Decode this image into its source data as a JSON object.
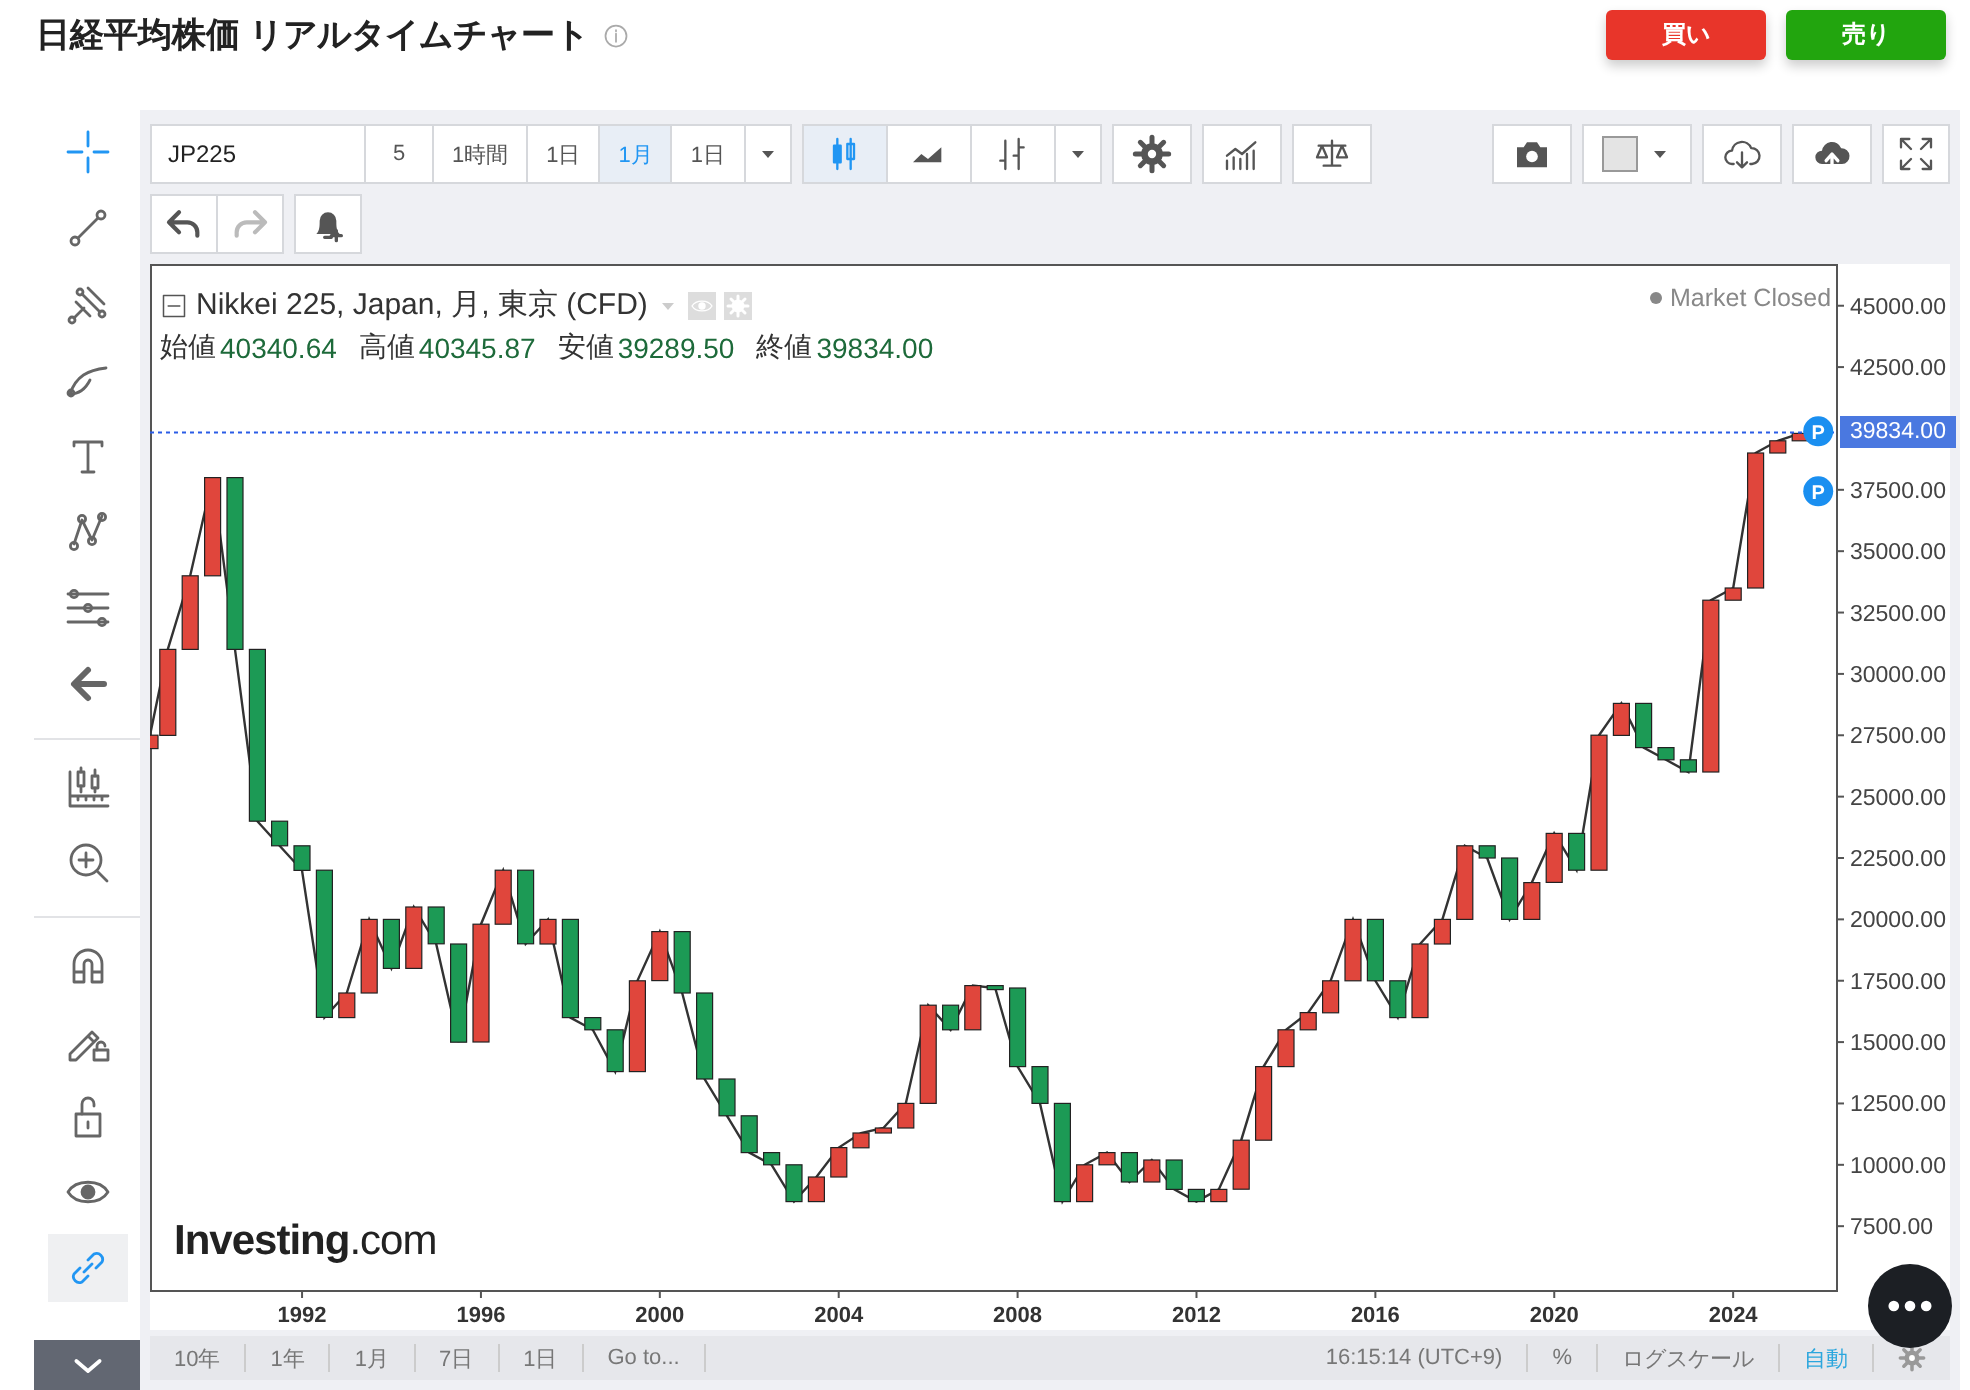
{
  "header": {
    "title": "日経平均株価 リアルタイムチャート",
    "buttons": [
      {
        "label": "買い",
        "kind": "buy"
      },
      {
        "label": "売り",
        "kind": "sell"
      }
    ]
  },
  "drawing_tools": [
    [
      {
        "kind": "crosshair",
        "selected": true,
        "on": false
      },
      {
        "kind": "trend-line",
        "selected": false,
        "on": false
      },
      {
        "kind": "pitchfork",
        "selected": false,
        "on": false
      },
      {
        "kind": "brush",
        "selected": false,
        "on": false
      },
      {
        "kind": "text",
        "selected": false,
        "on": false
      },
      {
        "kind": "pattern",
        "selected": false,
        "on": false
      },
      {
        "kind": "fib",
        "selected": false,
        "on": false
      },
      {
        "kind": "back",
        "selected": false,
        "on": false
      }
    ],
    [
      {
        "kind": "measure",
        "selected": false,
        "on": false
      },
      {
        "kind": "zoom",
        "selected": false,
        "on": false
      }
    ],
    [
      {
        "kind": "magnet",
        "selected": false,
        "on": false
      },
      {
        "kind": "pencil-lock",
        "selected": false,
        "on": false
      },
      {
        "kind": "lock",
        "selected": false,
        "on": false
      },
      {
        "kind": "eye",
        "selected": false,
        "on": false
      },
      {
        "kind": "link",
        "selected": true,
        "on": true
      }
    ]
  ],
  "toolbar": {
    "symbol": "JP225",
    "intervals": [
      {
        "label": "5",
        "selected": false
      },
      {
        "label": "1時間",
        "selected": false
      },
      {
        "label": "1日",
        "selected": false
      },
      {
        "label": "1月",
        "selected": true
      },
      {
        "label": "1日",
        "selected": false
      }
    ],
    "chart_types": [
      {
        "kind": "candles",
        "selected": true
      },
      {
        "kind": "area",
        "selected": false
      },
      {
        "kind": "bars",
        "selected": false
      }
    ],
    "actions": [
      {
        "kind": "settings"
      },
      {
        "kind": "indicators"
      },
      {
        "kind": "scale"
      }
    ],
    "right_actions": [
      {
        "kind": "camera"
      },
      {
        "kind": "color"
      },
      {
        "kind": "cloud-down"
      },
      {
        "kind": "cloud-up"
      },
      {
        "kind": "fullscreen"
      }
    ],
    "history": [
      {
        "kind": "undo",
        "disabled": false
      },
      {
        "kind": "redo",
        "disabled": true
      },
      {
        "kind": "alert",
        "disabled": false
      }
    ]
  },
  "legend": {
    "title": "Nikkei 225, Japan, 月, 東京 (CFD)",
    "ohlc": [
      {
        "label": "始値",
        "value": "40340.64"
      },
      {
        "label": "高値",
        "value": "40345.87"
      },
      {
        "label": "安値",
        "value": "39289.50"
      },
      {
        "label": "終値",
        "value": "39834.00"
      }
    ],
    "status": "Market Closed",
    "logo": "**Investing**.com"
  },
  "chart_data": {
    "type": "line",
    "xlim": [
      1988.6,
      2026.3
    ],
    "ylim": [
      4900,
      46700
    ],
    "xticks": [
      1992,
      1996,
      2000,
      2004,
      2008,
      2012,
      2016,
      2020,
      2024
    ],
    "yticks": [
      {
        "value": 7500,
        "label": "7500.00"
      },
      {
        "value": 10000,
        "label": "10000.00"
      },
      {
        "value": 12500,
        "label": "12500.00"
      },
      {
        "value": 15000,
        "label": "15000.00"
      },
      {
        "value": 17500,
        "label": "17500.00"
      },
      {
        "value": 20000,
        "label": "20000.00"
      },
      {
        "value": 22500,
        "label": "22500.00"
      },
      {
        "value": 25000,
        "label": "25000.00"
      },
      {
        "value": 27500,
        "label": "27500.00"
      },
      {
        "value": 30000,
        "label": "30000.00"
      },
      {
        "value": 32500,
        "label": "32500.00"
      },
      {
        "value": 35000,
        "label": "35000.00"
      },
      {
        "value": 37500,
        "label": "37500.00"
      },
      {
        "value": 42500,
        "label": "42500.00"
      },
      {
        "value": 45000,
        "label": "45000.00"
      }
    ],
    "x": [
      1988.6,
      1989.0,
      1989.5,
      1990.0,
      1990.5,
      1991.0,
      1991.5,
      1992.0,
      1992.5,
      1993.0,
      1993.5,
      1994.0,
      1994.5,
      1995.0,
      1995.5,
      1996.0,
      1996.5,
      1997.0,
      1997.5,
      1998.0,
      1998.5,
      1999.0,
      1999.5,
      2000.0,
      2000.5,
      2001.0,
      2001.5,
      2002.0,
      2002.5,
      2003.0,
      2003.5,
      2004.0,
      2004.5,
      2005.0,
      2005.5,
      2006.0,
      2006.5,
      2007.0,
      2007.5,
      2008.0,
      2008.5,
      2009.0,
      2009.5,
      2010.0,
      2010.5,
      2011.0,
      2011.5,
      2012.0,
      2012.5,
      2013.0,
      2013.5,
      2014.0,
      2014.5,
      2015.0,
      2015.5,
      2016.0,
      2016.5,
      2017.0,
      2017.5,
      2018.0,
      2018.5,
      2019.0,
      2019.5,
      2020.0,
      2020.5,
      2021.0,
      2021.5,
      2022.0,
      2022.5,
      2023.0,
      2023.5,
      2024.0,
      2024.5,
      2025.0,
      2025.5
    ],
    "series": [
      {
        "color": "#333333",
        "values": [
          27500,
          31000,
          34000,
          38000,
          31000,
          24000,
          23000,
          22000,
          16000,
          17000,
          20000,
          18000,
          20500,
          19000,
          15000,
          19800,
          22000,
          19000,
          20000,
          16000,
          15500,
          13800,
          17500,
          19500,
          17000,
          13500,
          12000,
          10500,
          10000,
          8500,
          9500,
          10700,
          11300,
          11500,
          12500,
          16500,
          15500,
          17300,
          17200,
          14000,
          12500,
          8500,
          10000,
          10500,
          9300,
          10200,
          9000,
          8500,
          9000,
          11000,
          14000,
          15500,
          16200,
          17500,
          20000,
          17500,
          16000,
          19000,
          20000,
          23000,
          22500,
          20000,
          21500,
          23500,
          22000,
          27500,
          28800,
          27000,
          26500,
          26000,
          33000,
          33500,
          39000,
          39500,
          39800
        ]
      }
    ],
    "ref_lines": [
      {
        "axis": "y",
        "value": 39834,
        "label": "39834.00"
      }
    ],
    "annotations": [
      "P",
      "P"
    ]
  },
  "bottom_bar": {
    "ranges": [
      "10年",
      "1年",
      "1月",
      "7日",
      "1日"
    ],
    "goto": "Go to...",
    "time": "16:15:14 (UTC+9)",
    "options": [
      {
        "label": "%",
        "selected": false
      },
      {
        "label": "ログスケール",
        "selected": false
      },
      {
        "label": "自動",
        "selected": true
      }
    ]
  }
}
